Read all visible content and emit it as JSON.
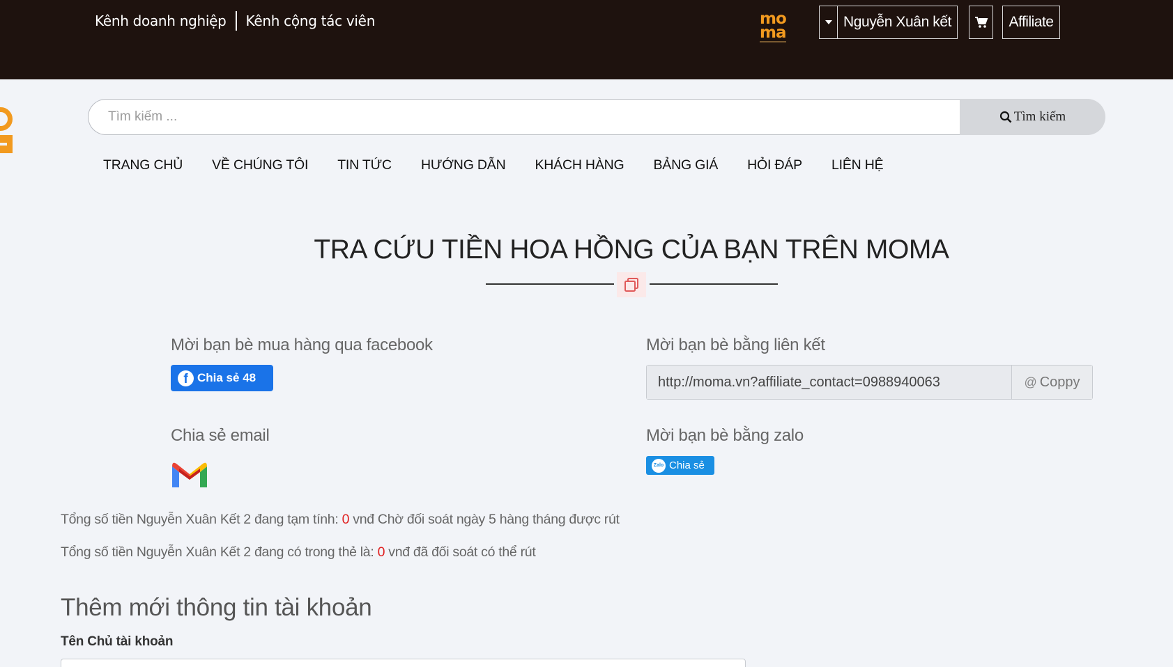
{
  "header": {
    "channel_business": "Kênh doanh nghiệp",
    "channel_collaborator": "Kênh cộng tác viên",
    "logo_line1": "mo",
    "logo_line2": "ma",
    "user_name": "Nguyễn Xuân kết",
    "affiliate_label": "Affiliate"
  },
  "search": {
    "placeholder": "Tìm kiếm ...",
    "button_label": "Tìm kiếm"
  },
  "nav": {
    "items": [
      "TRANG CHỦ",
      "VỀ CHÚNG TÔI",
      "TIN TỨC",
      "HƯỚNG DẪN",
      "KHÁCH HÀNG",
      "BẢNG GIÁ",
      "HỎI ĐÁP",
      "LIÊN HỆ"
    ]
  },
  "main": {
    "title": "TRA CỨU TIỀN HOA HỒNG CỦA BẠN TRÊN MOMA",
    "facebook_label": "Mời bạn bè mua hàng qua facebook",
    "facebook_button": "Chia sẻ 48",
    "link_label": "Mời bạn bè bằng liên kết",
    "link_value": "http://moma.vn?affiliate_contact=0988940063",
    "copy_label": "Coppy",
    "email_label": "Chia sẻ email",
    "zalo_label": "Mời bạn bè bằng zalo",
    "zalo_button": "Chia sẻ",
    "zalo_icon_text": "Zalo",
    "pending_prefix": "Tổng số tiền Nguyễn Xuân Kết 2 đang tạm tính:",
    "pending_amount": "0",
    "pending_suffix": "vnđ Chờ đối soát ngày 5 hàng tháng được rút",
    "available_prefix": "Tổng số tiền Nguyễn Xuân Kết 2 đang có trong thẻ là:",
    "available_amount": "0",
    "available_suffix": "vnđ đã đối soát có thể rút",
    "section_title": "Thêm mới thông tin tài khoản",
    "account_owner_label": "Tên Chủ tài khoản"
  },
  "colors": {
    "topbar": "#1e120e",
    "brand_orange": "#f29a1f",
    "facebook_blue": "#1a73e8",
    "zalo_blue": "#1a8fe3",
    "amount_red": "#e02020"
  }
}
